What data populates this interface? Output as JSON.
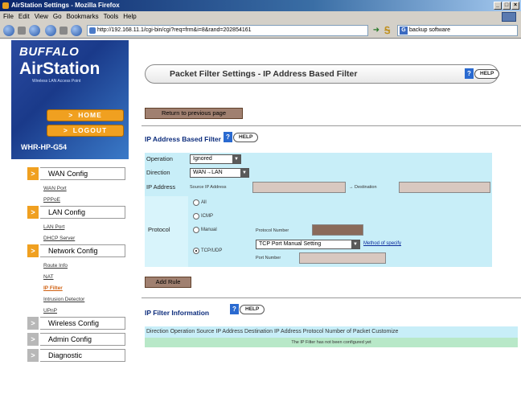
{
  "browser": {
    "title": "AirStation Settings - Mozilla Firefox",
    "menu": [
      "File",
      "Edit",
      "View",
      "Go",
      "Bookmarks",
      "Tools",
      "Help"
    ],
    "url": "http://192.168.11.1/cgi-bin/cgi?req=frm&i=8&rand=202854161",
    "search_text": "backup software"
  },
  "sidebar": {
    "brand": "BUFFALO",
    "product": "AirStation",
    "tagline": "Wireless LAN Access Point",
    "home": "HOME",
    "logout": "LOGOUT",
    "model": "WHR-HP-G54",
    "sections": [
      {
        "label": "WAN Config",
        "items": [
          "WAN Port",
          "PPPoE"
        ]
      },
      {
        "label": "LAN Config",
        "items": [
          "LAN Port",
          "DHCP Server"
        ]
      },
      {
        "label": "Network Config",
        "items": [
          "Route Info",
          "NAT",
          "IP Filter",
          "Intrusion Detector",
          "UPnP"
        ]
      },
      {
        "label": "Wireless Config"
      },
      {
        "label": "Admin Config"
      },
      {
        "label": "Diagnostic"
      }
    ]
  },
  "main": {
    "page_title": "Packet Filter Settings - IP Address Based Filter",
    "help": "HELP",
    "return_button": "Return to previous page",
    "section_filter": "IP Address Based Filter",
    "form": {
      "operation_label": "Operation",
      "operation_value": "Ignored",
      "direction_label": "Direction",
      "direction_value": "WAN→LAN",
      "ipaddress_label": "IP Address",
      "source_label": "Source IP Address",
      "dest_label": "→ Destination",
      "protocol_label": "Protocol",
      "opt_all": "All",
      "opt_icmp": "ICMP",
      "opt_manual": "Manual",
      "protocol_number_label": "Protocol Number",
      "opt_tcpudp": "TCP/UDP",
      "tcp_method_value": "TCP Port Manual Setting",
      "method_link": "Method of specify",
      "port_number_label": "Port Number"
    },
    "add_rule": "Add Rule",
    "section_info": "IP Filter Information",
    "info_header": "Direction Operation Source IP Address Destination IP Address Protocol Number of Packet Customize",
    "info_empty": "The IP Filter has not been configured yet"
  }
}
